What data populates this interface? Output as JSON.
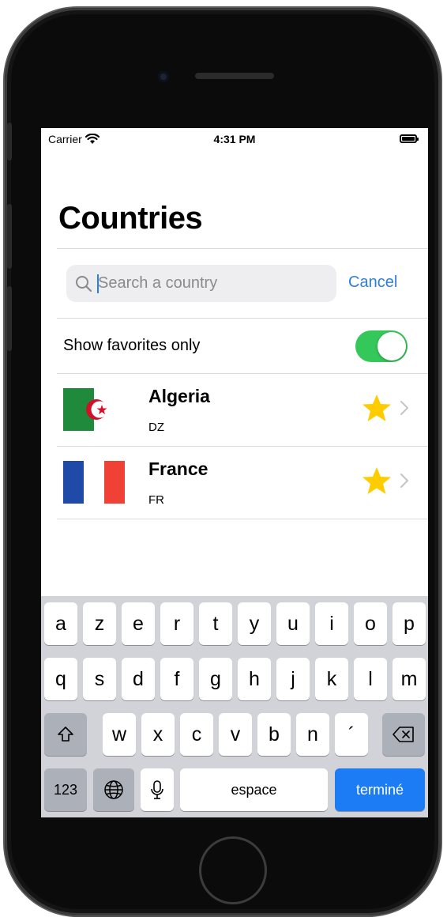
{
  "status_bar": {
    "carrier": "Carrier",
    "time": "4:31 PM"
  },
  "nav": {
    "title": "Countries"
  },
  "search": {
    "placeholder": "Search a country",
    "value": "",
    "cancel_label": "Cancel"
  },
  "favorites_filter": {
    "label": "Show favorites only",
    "enabled": true
  },
  "countries": [
    {
      "name": "Algeria",
      "code": "DZ",
      "favorite": true
    },
    {
      "name": "France",
      "code": "FR",
      "favorite": true
    }
  ],
  "keyboard": {
    "row1": [
      "a",
      "z",
      "e",
      "r",
      "t",
      "y",
      "u",
      "i",
      "o",
      "p"
    ],
    "row2": [
      "q",
      "s",
      "d",
      "f",
      "g",
      "h",
      "j",
      "k",
      "l",
      "m"
    ],
    "row3": [
      "w",
      "x",
      "c",
      "v",
      "b",
      "n",
      "´"
    ],
    "numbers_key": "123",
    "space_key": "espace",
    "return_key": "terminé"
  },
  "colors": {
    "accent": "#2f7fd8",
    "toggle_on": "#34c759",
    "star": "#ffcc00",
    "done_key": "#1b7cf5"
  }
}
